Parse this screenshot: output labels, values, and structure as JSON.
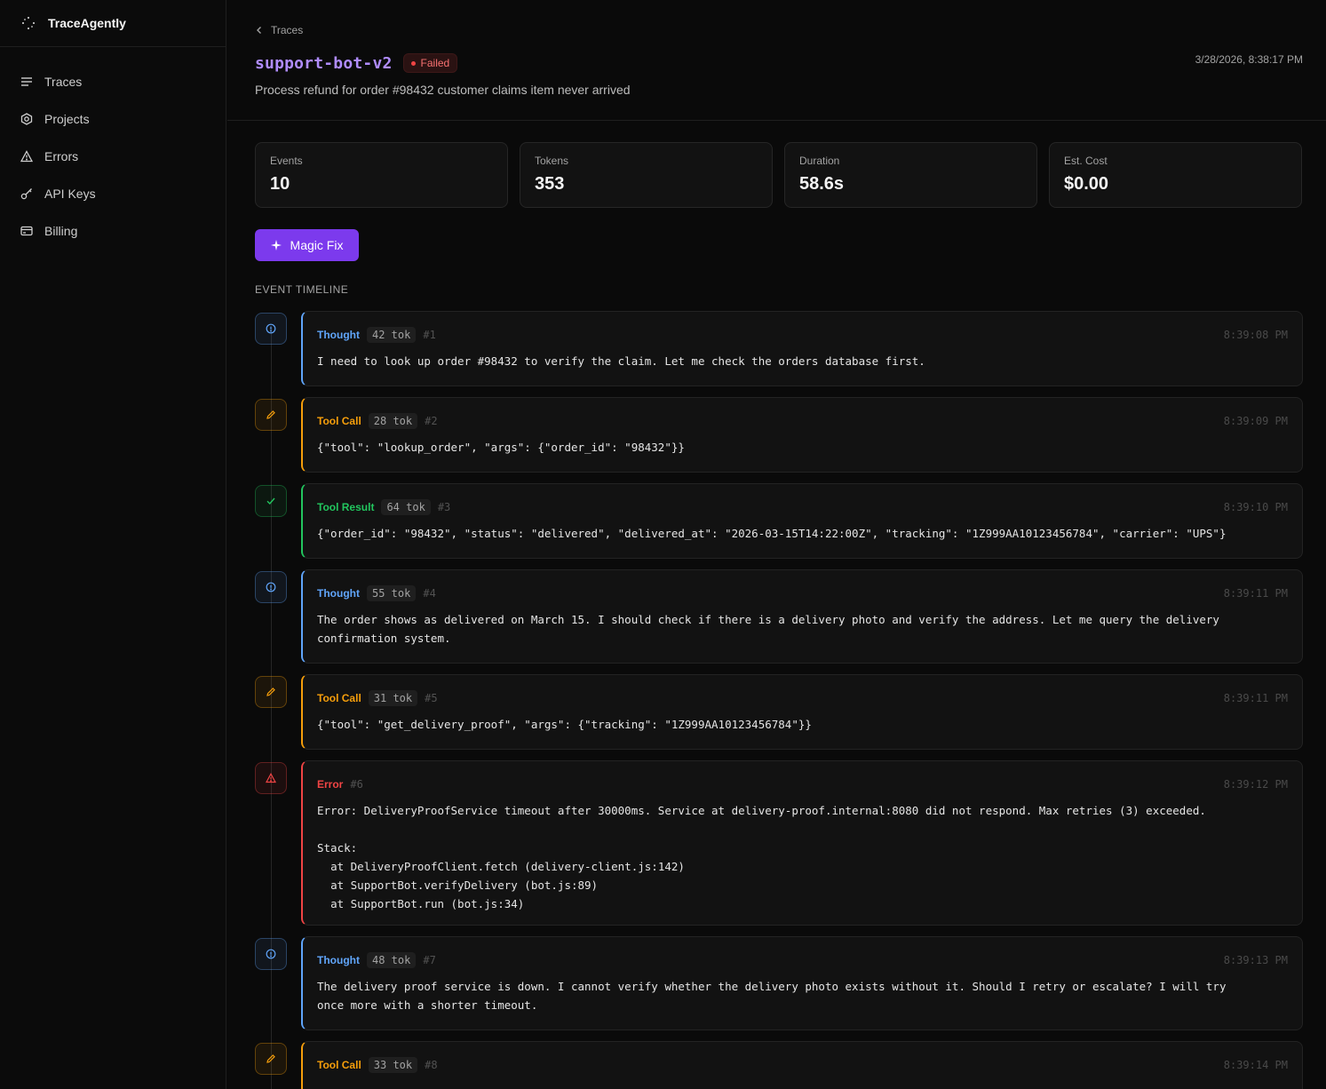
{
  "brand": {
    "name": "TraceAgently"
  },
  "sidebar": {
    "items": [
      {
        "label": "Traces",
        "icon": "list-icon"
      },
      {
        "label": "Projects",
        "icon": "hexagon-icon"
      },
      {
        "label": "Errors",
        "icon": "warning-triangle-icon"
      },
      {
        "label": "API Keys",
        "icon": "key-icon"
      },
      {
        "label": "Billing",
        "icon": "card-icon"
      }
    ]
  },
  "header": {
    "breadcrumb": "Traces",
    "title": "support-bot-v2",
    "status": "Failed",
    "subtitle": "Process refund for order #98432 customer claims item never arrived",
    "timestamp": "3/28/2026, 8:38:17 PM"
  },
  "stats": [
    {
      "label": "Events",
      "value": "10"
    },
    {
      "label": "Tokens",
      "value": "353"
    },
    {
      "label": "Duration",
      "value": "58.6s"
    },
    {
      "label": "Est. Cost",
      "value": "$0.00"
    }
  ],
  "actions": {
    "magic_fix": "Magic Fix"
  },
  "timeline": {
    "label": "EVENT TIMELINE",
    "events": [
      {
        "type": "Thought",
        "tokens": "42 tok",
        "index": "#1",
        "time": "8:39:08 PM",
        "content": "I need to look up order #98432 to verify the claim. Let me check the orders database first."
      },
      {
        "type": "Tool Call",
        "tokens": "28 tok",
        "index": "#2",
        "time": "8:39:09 PM",
        "content": "{\"tool\": \"lookup_order\", \"args\": {\"order_id\": \"98432\"}}"
      },
      {
        "type": "Tool Result",
        "tokens": "64 tok",
        "index": "#3",
        "time": "8:39:10 PM",
        "content": "{\"order_id\": \"98432\", \"status\": \"delivered\", \"delivered_at\": \"2026-03-15T14:22:00Z\", \"tracking\": \"1Z999AA10123456784\", \"carrier\": \"UPS\"}"
      },
      {
        "type": "Thought",
        "tokens": "55 tok",
        "index": "#4",
        "time": "8:39:11 PM",
        "content": "The order shows as delivered on March 15. I should check if there is a delivery photo and verify the address. Let me query the delivery\nconfirmation system."
      },
      {
        "type": "Tool Call",
        "tokens": "31 tok",
        "index": "#5",
        "time": "8:39:11 PM",
        "content": "{\"tool\": \"get_delivery_proof\", \"args\": {\"tracking\": \"1Z999AA10123456784\"}}"
      },
      {
        "type": "Error",
        "tokens": "",
        "index": "#6",
        "time": "8:39:12 PM",
        "content": "Error: DeliveryProofService timeout after 30000ms. Service at delivery-proof.internal:8080 did not respond. Max retries (3) exceeded.\n\nStack:\n  at DeliveryProofClient.fetch (delivery-client.js:142)\n  at SupportBot.verifyDelivery (bot.js:89)\n  at SupportBot.run (bot.js:34)"
      },
      {
        "type": "Thought",
        "tokens": "48 tok",
        "index": "#7",
        "time": "8:39:13 PM",
        "content": "The delivery proof service is down. I cannot verify whether the delivery photo exists without it. Should I retry or escalate? I will try\nonce more with a shorter timeout."
      },
      {
        "type": "Tool Call",
        "tokens": "33 tok",
        "index": "#8",
        "time": "8:39:14 PM",
        "content": ""
      }
    ]
  },
  "colors": {
    "thought": "#60a5fa",
    "tool_call": "#f59e0b",
    "tool_result": "#22c55e",
    "error": "#ef4444",
    "accent": "#7c3aed",
    "title": "#b08cff"
  }
}
